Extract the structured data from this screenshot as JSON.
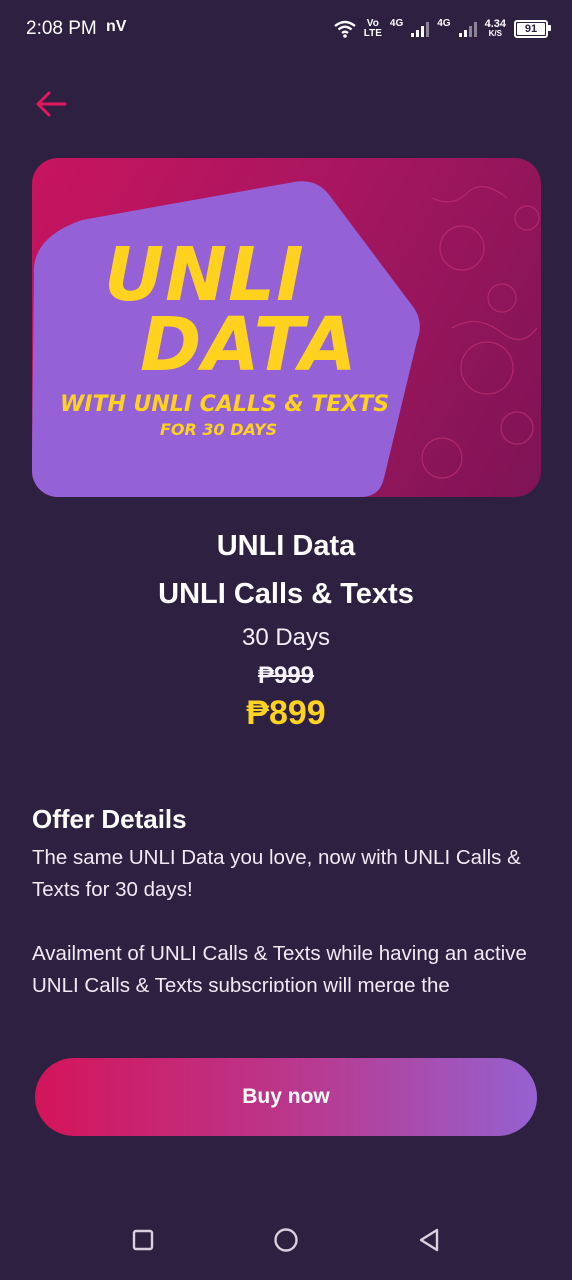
{
  "status_bar": {
    "time": "2:08 PM",
    "carrier_icon": "nV",
    "volte_line1": "Vo",
    "volte_line2": "LTE",
    "net1": "4G",
    "net2": "4G",
    "speed_value": "4.34",
    "speed_unit": "K/S",
    "battery": "91"
  },
  "header": {
    "back_icon": "arrow-left-icon",
    "accent_color": "#e0195f"
  },
  "banner": {
    "line1": "UNLI",
    "line2": "DATA",
    "subline1": "WITH UNLI CALLS & TEXTS",
    "subline2": "FOR 30 DAYS",
    "text_color": "#ffd21f"
  },
  "product": {
    "title_line1": "UNLI Data",
    "title_line2": "UNLI Calls & Texts",
    "duration": "30 Days",
    "old_price": "₱999",
    "new_price": "₱899"
  },
  "offer": {
    "heading": "Offer Details",
    "paragraphs": [
      "The same UNLI Data you love, now with UNLI Calls & Texts for 30 days!",
      "Availment of UNLI Calls & Texts while having an active UNLI Calls & Texts subscription will merge the"
    ]
  },
  "actions": {
    "buy_label": "Buy now"
  },
  "nav_bar": {
    "recent_icon": "square-icon",
    "home_icon": "circle-icon",
    "back_icon": "triangle-back-icon"
  }
}
